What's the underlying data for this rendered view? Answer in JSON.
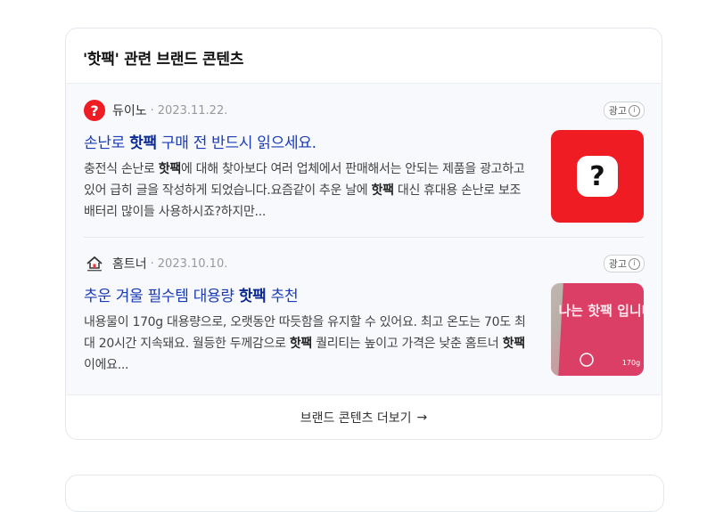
{
  "section": {
    "title": "'핫팩' 관련 브랜드 콘텐츠",
    "more_label": "브랜드 콘텐츠 더보기",
    "more_arrow": "→"
  },
  "items": [
    {
      "source": "듀이노",
      "dot": "·",
      "date": "2023.11.22.",
      "ad_label": "광고",
      "title_pre": "손난로 ",
      "title_kw": "핫팩",
      "title_post": " 구매 전 반드시 읽으세요.",
      "desc": [
        {
          "t": "충전식 손난로 "
        },
        {
          "t": "핫팩",
          "b": true
        },
        {
          "t": "에 대해 찾아보다 여러 업체에서 판매해서는 안되는 제품을 광고하고 있어 급히 글을 작성하게 되었습니다.요즘같이 추운 날에 "
        },
        {
          "t": "핫팩",
          "b": true
        },
        {
          "t": " 대신 휴대용 손난로 보조배터리 많이들 사용하시죠?하지만..."
        }
      ],
      "thumb_glyph": "?"
    },
    {
      "source": "홈트너",
      "dot": "·",
      "date": "2023.10.10.",
      "ad_label": "광고",
      "title_pre": "추운 겨울 필수템 대용량 ",
      "title_kw": "핫팩",
      "title_post": " 추천",
      "desc": [
        {
          "t": "내용물이 170g 대용량으로, 오랫동안 따듯함을 유지할 수 있어요. 최고 온도는 70도 최대 20시간 지속돼요. 월등한 두께감으로 "
        },
        {
          "t": "핫팩",
          "b": true
        },
        {
          "t": " 퀄리티는 높이고 가격은 낮춘 홈트너 "
        },
        {
          "t": "핫팩",
          "b": true
        },
        {
          "t": "이에요..."
        }
      ],
      "thumb_text": "나는 핫팩 입니다",
      "thumb_weight": "170g"
    }
  ],
  "colors": {
    "title_link": "#1a3bb3",
    "keyword": "#0b2a91",
    "brand_red": "#ef1c24"
  }
}
